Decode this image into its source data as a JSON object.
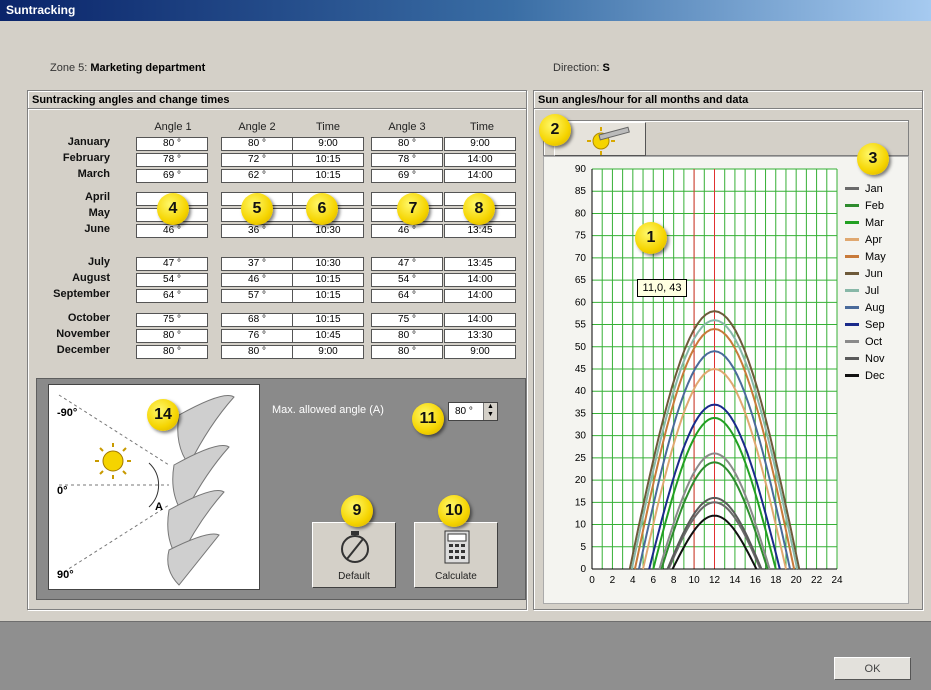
{
  "window": {
    "title": "Suntracking"
  },
  "zone": {
    "prefix": "Zone 5:",
    "name": "Marketing department"
  },
  "direction": {
    "prefix": "Direction:",
    "value": "S"
  },
  "left_panel": {
    "title": "Suntracking angles and change times"
  },
  "right_panel": {
    "title": "Sun angles/hour for all months and data"
  },
  "table": {
    "headers": [
      "Angle 1",
      "Angle 2",
      "Time",
      "Angle 3",
      "Time"
    ],
    "rows": [
      {
        "month": "January",
        "angle1": "80 °",
        "angle2": "80 °",
        "time1": "9:00",
        "angle3": "80 °",
        "time2": "9:00"
      },
      {
        "month": "February",
        "angle1": "78 °",
        "angle2": "72 °",
        "time1": "10:15",
        "angle3": "78 °",
        "time2": "14:00"
      },
      {
        "month": "March",
        "angle1": "69 °",
        "angle2": "62 °",
        "time1": "10:15",
        "angle3": "69 °",
        "time2": "14:00"
      },
      {
        "month": "April",
        "angle1": "",
        "angle2": "",
        "time1": "",
        "angle3": "",
        "time2": ""
      },
      {
        "month": "May",
        "angle1": "",
        "angle2": "",
        "time1": "",
        "angle3": "",
        "time2": ""
      },
      {
        "month": "June",
        "angle1": "46 °",
        "angle2": "36 °",
        "time1": "10:30",
        "angle3": "46 °",
        "time2": "13:45"
      },
      {
        "month": "July",
        "angle1": "47 °",
        "angle2": "37 °",
        "time1": "10:30",
        "angle3": "47 °",
        "time2": "13:45"
      },
      {
        "month": "August",
        "angle1": "54 °",
        "angle2": "46 °",
        "time1": "10:15",
        "angle3": "54 °",
        "time2": "14:00"
      },
      {
        "month": "September",
        "angle1": "64 °",
        "angle2": "57 °",
        "time1": "10:15",
        "angle3": "64 °",
        "time2": "14:00"
      },
      {
        "month": "October",
        "angle1": "75 °",
        "angle2": "68 °",
        "time1": "10:15",
        "angle3": "75 °",
        "time2": "14:00"
      },
      {
        "month": "November",
        "angle1": "80 °",
        "angle2": "76 °",
        "time1": "10:45",
        "angle3": "80 °",
        "time2": "13:30"
      },
      {
        "month": "December",
        "angle1": "80 °",
        "angle2": "80 °",
        "time1": "9:00",
        "angle3": "80 °",
        "time2": "9:00"
      }
    ]
  },
  "diagram": {
    "label_top": "-90°",
    "label_mid": "0°",
    "label_bottom": "90°",
    "label_angle": "A"
  },
  "max_angle": {
    "label": "Max. allowed angle (A)",
    "value": "80 °"
  },
  "buttons": {
    "default": "Default",
    "calculate": "Calculate",
    "ok": "OK"
  },
  "badges": [
    "1",
    "2",
    "3",
    "4",
    "5",
    "6",
    "7",
    "8",
    "9",
    "10",
    "11",
    "14"
  ],
  "tooltip": "11,0, 43",
  "chart_data": {
    "type": "line",
    "x_ticks": [
      "0",
      "2",
      "4",
      "6",
      "8",
      "10",
      "12",
      "14",
      "16",
      "18",
      "20",
      "22",
      "24"
    ],
    "y_ticks": [
      "0",
      "5",
      "10",
      "15",
      "20",
      "25",
      "30",
      "35",
      "40",
      "45",
      "50",
      "55",
      "60",
      "65",
      "70",
      "75",
      "80",
      "85",
      "90"
    ],
    "xlim": [
      0,
      24
    ],
    "ylim": [
      0,
      90
    ],
    "grid": true,
    "legend_position": "right",
    "marker_x": [
      10,
      12
    ],
    "series": [
      {
        "name": "Jan",
        "peak": 15,
        "start": 7.5,
        "end": 16.5,
        "color": "#6a6a6a"
      },
      {
        "name": "Feb",
        "peak": 24,
        "start": 6.8,
        "end": 17.2,
        "color": "#2e8b2e"
      },
      {
        "name": "Mar",
        "peak": 34,
        "start": 6,
        "end": 18,
        "color": "#22a022"
      },
      {
        "name": "Apr",
        "peak": 45,
        "start": 5,
        "end": 19,
        "color": "#e0a870"
      },
      {
        "name": "May",
        "peak": 54,
        "start": 4.2,
        "end": 19.8,
        "color": "#c87a3a"
      },
      {
        "name": "Jun",
        "peak": 58,
        "start": 3.7,
        "end": 20.3,
        "color": "#6e5a3a"
      },
      {
        "name": "Jul",
        "peak": 56,
        "start": 3.9,
        "end": 20.1,
        "color": "#88b8a8"
      },
      {
        "name": "Aug",
        "peak": 49,
        "start": 4.6,
        "end": 19.4,
        "color": "#4a6a9a"
      },
      {
        "name": "Sep",
        "peak": 37,
        "start": 5.6,
        "end": 18.4,
        "color": "#1a2a8a"
      },
      {
        "name": "Oct",
        "peak": 26,
        "start": 6.6,
        "end": 17.4,
        "color": "#8a8a8a"
      },
      {
        "name": "Nov",
        "peak": 16,
        "start": 7.4,
        "end": 16.6,
        "color": "#5a5a5a"
      },
      {
        "name": "Dec",
        "peak": 12,
        "start": 7.9,
        "end": 16.1,
        "color": "#111111"
      }
    ]
  }
}
